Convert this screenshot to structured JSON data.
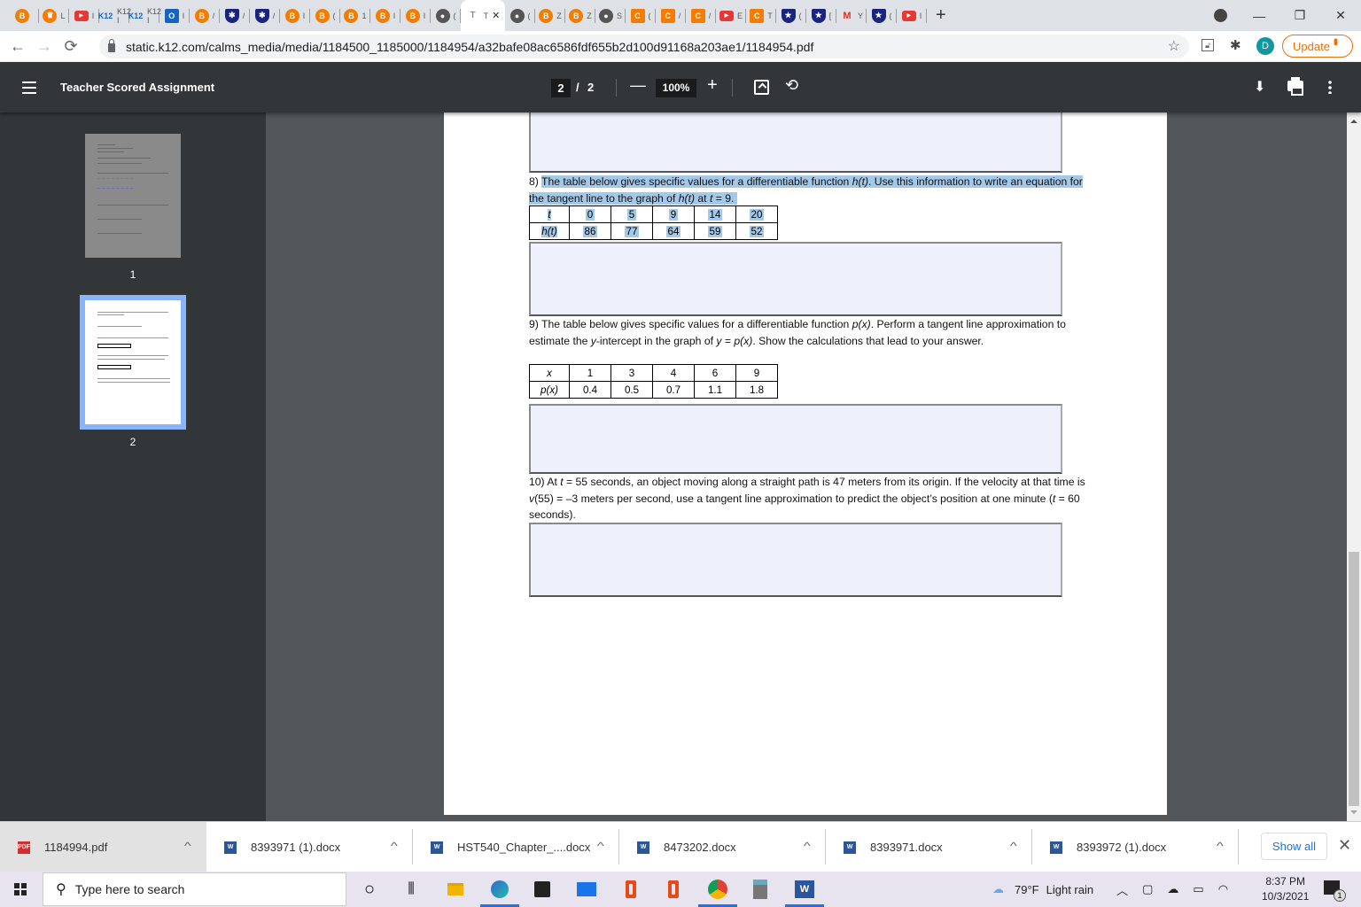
{
  "browser": {
    "tabs": [
      {
        "icon": "b",
        "label": ""
      },
      {
        "icon": "crest",
        "label": "L"
      },
      {
        "icon": "youtube",
        "label": "I"
      },
      {
        "icon": "k12",
        "label": "K12 I"
      },
      {
        "icon": "k12",
        "label": "K12 I"
      },
      {
        "icon": "outlook",
        "label": "I"
      },
      {
        "icon": "b",
        "label": "/"
      },
      {
        "icon": "spider",
        "label": "/"
      },
      {
        "icon": "spider",
        "label": "/"
      },
      {
        "icon": "b",
        "label": "I"
      },
      {
        "icon": "b",
        "label": "("
      },
      {
        "icon": "b",
        "label": "1"
      },
      {
        "icon": "b",
        "label": "l"
      },
      {
        "icon": "b",
        "label": "I"
      },
      {
        "icon": "globe",
        "label": "("
      },
      {
        "icon": "text",
        "label": "T",
        "active": true
      },
      {
        "icon": "globe",
        "label": "("
      },
      {
        "icon": "b",
        "label": "Z"
      },
      {
        "icon": "b",
        "label": "Z"
      },
      {
        "icon": "globe",
        "label": "S"
      },
      {
        "icon": "c",
        "label": "("
      },
      {
        "icon": "c",
        "label": "/"
      },
      {
        "icon": "c",
        "label": "/"
      },
      {
        "icon": "youtube",
        "label": "E"
      },
      {
        "icon": "c",
        "label": "T"
      },
      {
        "icon": "shield",
        "label": "("
      },
      {
        "icon": "shield",
        "label": "["
      },
      {
        "icon": "gmail",
        "label": "Y"
      },
      {
        "icon": "shield",
        "label": "("
      },
      {
        "icon": "youtube",
        "label": "I"
      }
    ],
    "new_tab": "+",
    "window_controls": {
      "minimize": "—",
      "restore": "❐",
      "close": "✕"
    },
    "url": "static.k12.com/calms_media/media/1184500_1185000/1184954/a32bafe08ac6586fdf655b2d100d91168a203ae1/1184954.pdf",
    "profile_initial": "D",
    "update_label": "Update",
    "accent_color": "#e8710a"
  },
  "pdf_toolbar": {
    "title": "Teacher Scored Assignment",
    "current_page": "2",
    "separator": "/",
    "total_pages": "2",
    "zoom": "100%",
    "zoom_out": "—",
    "zoom_in": "+"
  },
  "thumbnails": [
    {
      "page_number": "1",
      "selected": false
    },
    {
      "page_number": "2",
      "selected": true
    }
  ],
  "document": {
    "q8": {
      "number": "8)",
      "text_before": "The table below gives specific values for a differentiable function ",
      "fn": "h(t)",
      "text_mid": ". Use this information to write an equation for the tangent line to the graph of ",
      "fn2": "h(t)",
      "text_end": " at ",
      "var": "t",
      "text_tail": " = 9.",
      "table": {
        "row_headers": [
          "t",
          "h(t)"
        ],
        "rows": [
          [
            "0",
            "5",
            "9",
            "14",
            "20"
          ],
          [
            "86",
            "77",
            "64",
            "59",
            "52"
          ]
        ]
      }
    },
    "q9": {
      "number": "9)",
      "text_a": "The table below gives specific values for a differentiable function ",
      "fn": "p(x)",
      "text_b": ". Perform a tangent line approximation to estimate the ",
      "y": "y",
      "text_c": "-intercept in the graph of ",
      "y2": "y",
      "text_d": " = ",
      "fn2": "p(x)",
      "text_e": ". Show the calculations that lead to your answer.",
      "table": {
        "row_headers": [
          "x",
          "p(x)"
        ],
        "rows": [
          [
            "1",
            "3",
            "4",
            "6",
            "9"
          ],
          [
            "0.4",
            "0.5",
            "0.7",
            "1.1",
            "1.8"
          ]
        ]
      }
    },
    "q10": {
      "number": "10)",
      "text_a": "At ",
      "t": "t",
      "text_b": " = 55 seconds, an object moving along a straight path is 47 meters from its origin. If the velocity at that time is ",
      "v": "v",
      "text_c": "(55) = –3 meters per second, use a tangent line approximation to predict the object’s position at one minute (",
      "t2": "t",
      "text_d": " = 60 seconds)."
    }
  },
  "downloads": [
    {
      "name": "1184994.pdf",
      "type": "pdf"
    },
    {
      "name": "8393971 (1).docx",
      "type": "docx"
    },
    {
      "name": "HST540_Chapter_....docx",
      "type": "docx"
    },
    {
      "name": "8473202.docx",
      "type": "docx"
    },
    {
      "name": "8393971.docx",
      "type": "docx"
    },
    {
      "name": "8393972 (1).docx",
      "type": "docx"
    }
  ],
  "downloads_show_all": "Show all",
  "taskbar": {
    "search_placeholder": "Type here to search",
    "weather_temp": "79°F",
    "weather_desc": "Light rain",
    "time": "8:37 PM",
    "date": "10/3/2021",
    "notification_count": "1"
  }
}
